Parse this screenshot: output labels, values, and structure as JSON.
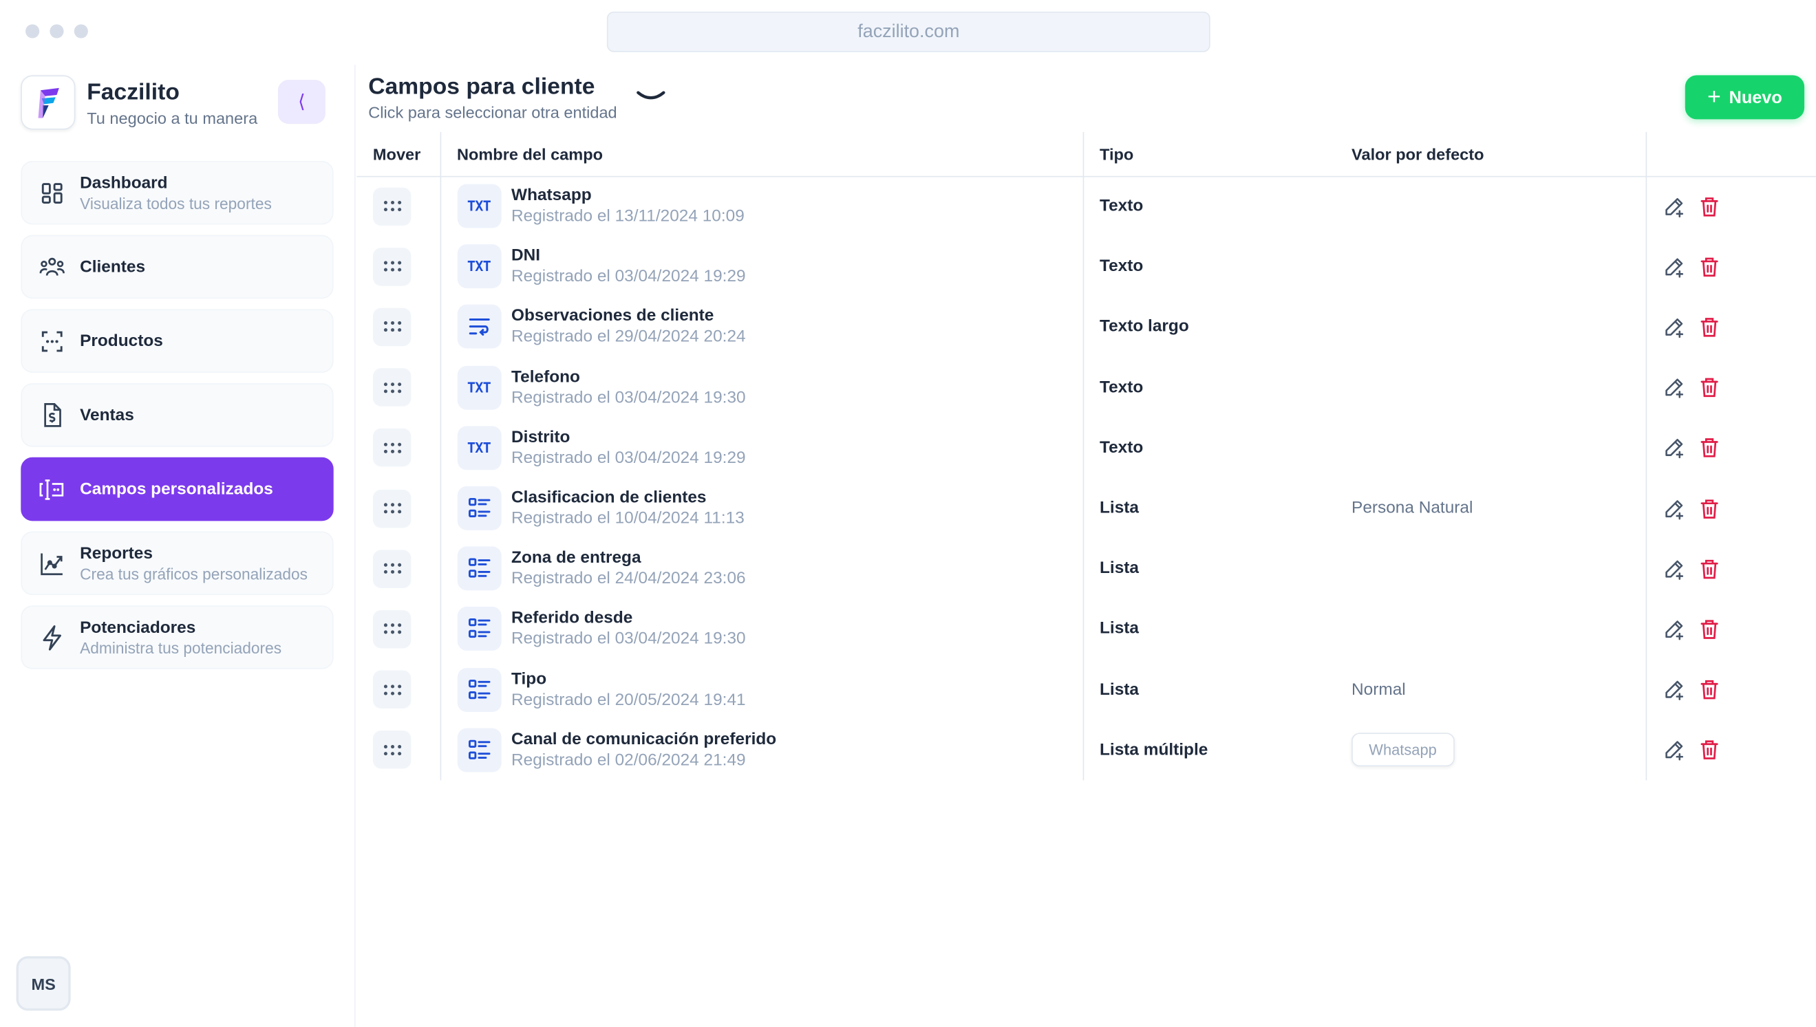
{
  "browser": {
    "url": "faczilito.com"
  },
  "brand": {
    "name": "Faczilito",
    "tagline": "Tu negocio a tu manera",
    "collapse_glyph": "⟨"
  },
  "nav": [
    {
      "label": "Dashboard",
      "sub": "Visualiza todos tus reportes",
      "icon": "dashboard-icon"
    },
    {
      "label": "Clientes",
      "sub": "",
      "icon": "users-icon"
    },
    {
      "label": "Productos",
      "sub": "",
      "icon": "barcode-icon"
    },
    {
      "label": "Ventas",
      "sub": "",
      "icon": "invoice-icon"
    },
    {
      "label": "Campos personalizados",
      "sub": "",
      "icon": "custom-fields-icon",
      "active": true
    },
    {
      "label": "Reportes",
      "sub": "Crea tus gráficos personalizados",
      "icon": "chart-icon"
    },
    {
      "label": "Potenciadores",
      "sub": "Administra tus potenciadores",
      "icon": "bolt-icon"
    }
  ],
  "user": {
    "initials": "MS"
  },
  "header": {
    "title": "Campos para cliente",
    "subtitle": "Click para seleccionar otra entidad",
    "new_label": "Nuevo"
  },
  "table": {
    "headers": {
      "move": "Mover",
      "name": "Nombre del campo",
      "type": "Tipo",
      "default": "Valor por defecto"
    },
    "rows": [
      {
        "name": "Whatsapp",
        "date": "Registrado el 13/11/2024 10:09",
        "type": "Texto",
        "default": "",
        "icon": "txt"
      },
      {
        "name": "DNI",
        "date": "Registrado el 03/04/2024 19:29",
        "type": "Texto",
        "default": "",
        "icon": "txt"
      },
      {
        "name": "Observaciones de cliente",
        "date": "Registrado el 29/04/2024 20:24",
        "type": "Texto largo",
        "default": "",
        "icon": "wrap"
      },
      {
        "name": "Telefono",
        "date": "Registrado el 03/04/2024 19:30",
        "type": "Texto",
        "default": "",
        "icon": "txt"
      },
      {
        "name": "Distrito",
        "date": "Registrado el 03/04/2024 19:29",
        "type": "Texto",
        "default": "",
        "icon": "txt"
      },
      {
        "name": "Clasificacion de clientes",
        "date": "Registrado el 10/04/2024 11:13",
        "type": "Lista",
        "default": "Persona Natural",
        "icon": "list"
      },
      {
        "name": "Zona de entrega",
        "date": "Registrado el 24/04/2024 23:06",
        "type": "Lista",
        "default": "",
        "icon": "list"
      },
      {
        "name": "Referido desde",
        "date": "Registrado el 03/04/2024 19:30",
        "type": "Lista",
        "default": "",
        "icon": "list"
      },
      {
        "name": "Tipo",
        "date": "Registrado el 20/05/2024 19:41",
        "type": "Lista",
        "default": "Normal",
        "icon": "list"
      },
      {
        "name": "Canal de comunicación preferido",
        "date": "Registrado el 02/06/2024 21:49",
        "type": "Lista múltiple",
        "default": "Whatsapp",
        "default_chip": true,
        "icon": "list"
      }
    ],
    "txt_badge": "TXT"
  },
  "colors": {
    "accent": "#7c3aed",
    "primary_button": "#16d46b",
    "delete": "#e11d48",
    "field_icon": "#1d4ed8"
  }
}
